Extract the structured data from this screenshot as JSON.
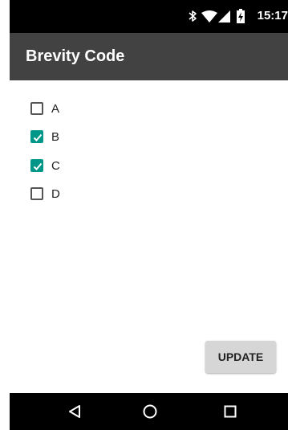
{
  "status_bar": {
    "time": "15:17",
    "icons": [
      "bluetooth-icon",
      "wifi-icon",
      "signal-icon",
      "battery-charging-icon"
    ]
  },
  "app_bar": {
    "title": "Brevity Code"
  },
  "options": [
    {
      "label": "A",
      "checked": false
    },
    {
      "label": "B",
      "checked": true
    },
    {
      "label": "C",
      "checked": true
    },
    {
      "label": "D",
      "checked": false
    }
  ],
  "update_button": {
    "label": "UPDATE"
  },
  "nav_bar": {
    "icons": [
      "back-icon",
      "home-icon",
      "recents-icon"
    ]
  },
  "colors": {
    "app_bar": "#424242",
    "accent": "#009688",
    "status_bar": "#000000",
    "nav_bar": "#000000",
    "button": "#d6d6d6"
  }
}
